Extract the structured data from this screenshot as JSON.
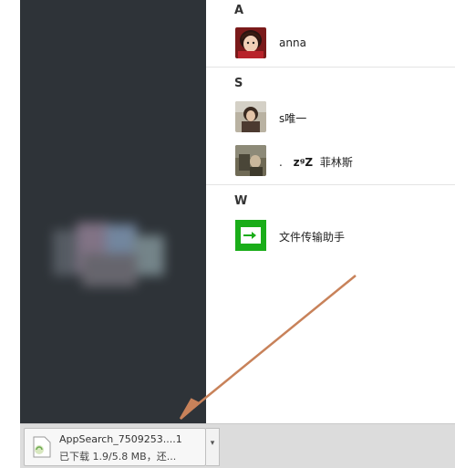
{
  "sections": [
    {
      "letter": "A",
      "contacts": [
        {
          "name": "anna",
          "zzz": "",
          "avatar": "anna-avatar"
        }
      ]
    },
    {
      "letter": "S",
      "contacts": [
        {
          "name": "s唯一",
          "zzz": "",
          "avatar": "s-avatar"
        },
        {
          "name": "菲林斯",
          "zzz": "zᶢZ",
          "prefix": ".",
          "avatar": "feilinsi-avatar"
        }
      ]
    },
    {
      "letter": "W",
      "contacts": [
        {
          "name": "文件传输助手",
          "zzz": "",
          "avatar": "file-transfer-avatar"
        }
      ]
    }
  ],
  "download": {
    "file_name": "AppSearch_7509253....1",
    "status": "已下载 1.9/5.8 MB，还...",
    "menu_icon": "chevron-down-icon"
  },
  "colors": {
    "left_pane": "#2e3338",
    "file_transfer_green": "#1aad19",
    "arrow": "#c8825a"
  }
}
